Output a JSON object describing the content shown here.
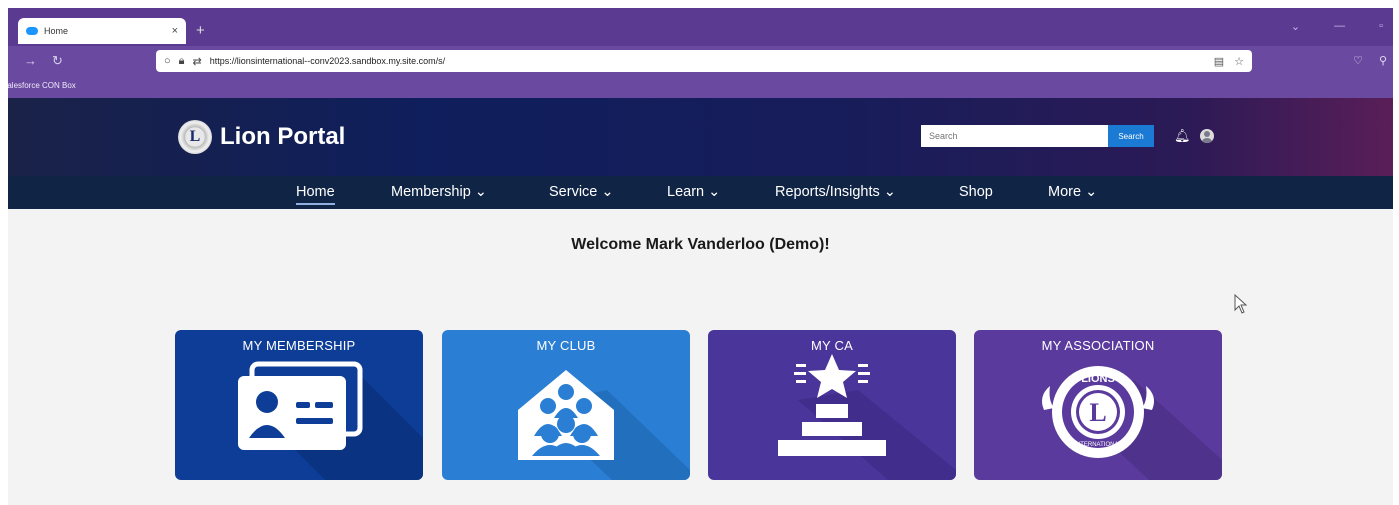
{
  "browser": {
    "tab_title": "Home",
    "tab_close": "×",
    "new_tab": "+",
    "url": "https://lionsinternational--conv2023.sandbox.my.site.com/s/",
    "bookmark": "Salesforce CON Box"
  },
  "site": {
    "brand_name": "Lion Portal",
    "brand_logo_letter": "L",
    "search_placeholder": "Search",
    "search_button": "Search"
  },
  "nav": {
    "items": [
      {
        "label": "Home"
      },
      {
        "label": "Membership ⌄"
      },
      {
        "label": "Service ⌄"
      },
      {
        "label": "Learn ⌄"
      },
      {
        "label": "Reports/Insights ⌄"
      },
      {
        "label": "Shop"
      },
      {
        "label": "More ⌄"
      }
    ],
    "active_index": 0
  },
  "main": {
    "welcome": "Welcome Mark Vanderloo (Demo)!",
    "tiles": [
      {
        "label": "MY MEMBERSHIP",
        "icon": "membership-card-icon",
        "color": "#0d3d97"
      },
      {
        "label": "MY CLUB",
        "icon": "club-people-icon",
        "color": "#2a7fd4"
      },
      {
        "label": "MY CA",
        "icon": "star-podium-icon",
        "color": "#4a359a"
      },
      {
        "label": "MY ASSOCIATION",
        "icon": "lions-emblem-icon",
        "color": "#5a3a9c"
      }
    ],
    "emblem_text_top": "LIONS",
    "emblem_text_bottom": "INTERNATIONAL",
    "emblem_letter": "L"
  }
}
